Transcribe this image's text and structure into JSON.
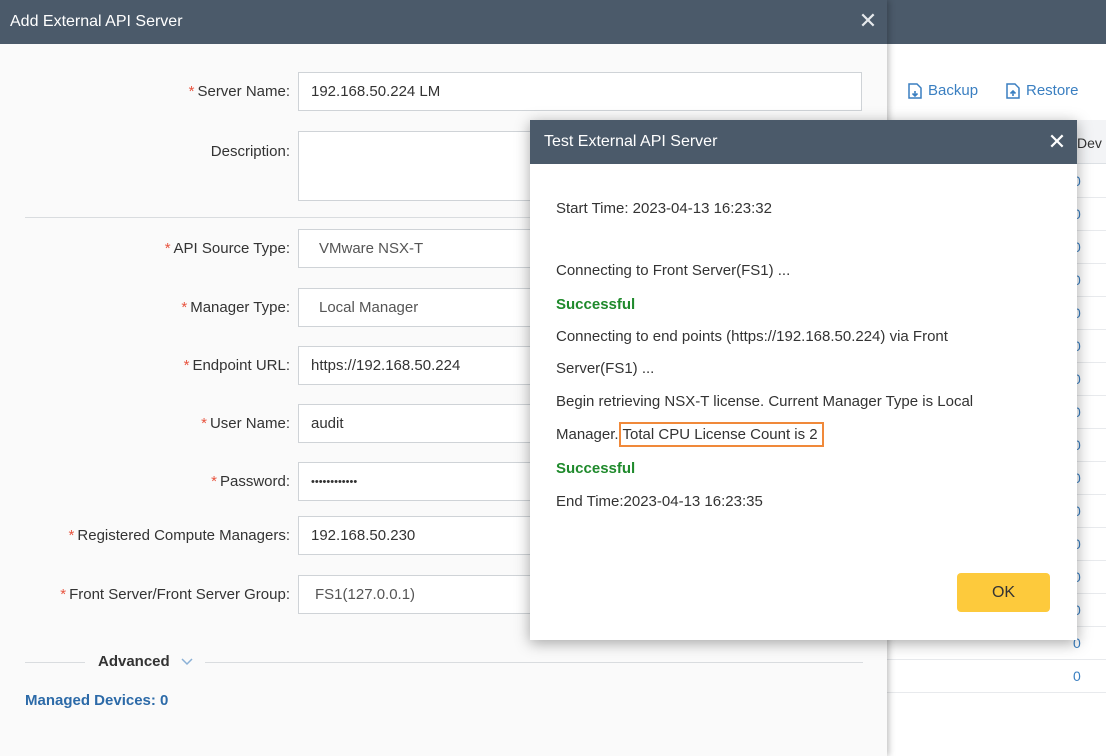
{
  "background": {
    "toolbar": {
      "backup_label": "Backup",
      "restore_label": "Restore"
    },
    "table": {
      "column_label": "Dev",
      "row_values": [
        "0",
        "0",
        "0",
        "0",
        "0",
        "0",
        "0",
        "0",
        "0",
        "0",
        "0",
        "0",
        "0",
        "0",
        "0",
        "0"
      ]
    }
  },
  "dialog": {
    "title": "Add External API Server",
    "required_mark": "*",
    "fields": {
      "server_name": {
        "label": "Server Name:",
        "value": "192.168.50.224 LM"
      },
      "description": {
        "label": "Description:",
        "value": ""
      },
      "api_source_type": {
        "label": "API Source Type:",
        "value": "VMware NSX-T"
      },
      "manager_type": {
        "label": "Manager Type:",
        "value": "Local Manager"
      },
      "endpoint_url": {
        "label": "Endpoint URL:",
        "value": "https://192.168.50.224"
      },
      "user_name": {
        "label": "User Name:",
        "value": "audit"
      },
      "password": {
        "label": "Password:",
        "value": "••••••••••••"
      },
      "compute_managers": {
        "label": "Registered Compute Managers:",
        "value": "192.168.50.230"
      },
      "front_server": {
        "label": "Front Server/Front Server Group:",
        "value": "FS1(127.0.0.1)"
      }
    },
    "advanced_label": "Advanced",
    "managed_devices": "Managed Devices: 0"
  },
  "modal": {
    "title": "Test External API Server",
    "log": {
      "start_time": "Start Time: 2023-04-13 16:23:32",
      "connecting_front": "Connecting to Front Server(FS1) ...",
      "successful_1": "Successful",
      "connecting_endpoints_1": "Connecting to end points (https://192.168.50.224) via Front",
      "connecting_endpoints_2": "Server(FS1) ...",
      "license_1": "Begin retrieving NSX-T license. Current Manager Type is Local",
      "license_2a": "Manager.",
      "license_2b": "Total CPU License Count is 2",
      "successful_2": "Successful",
      "end_time": "End Time:2023-04-13 16:23:35"
    },
    "ok_label": "OK"
  },
  "colors": {
    "header_bg": "#4b5a6a",
    "success_green": "#1f8a2c",
    "highlight_orange": "#f0893a",
    "ok_button_yellow": "#fdca3c",
    "link_blue": "#3a7fc1",
    "required_red": "#e8543f"
  },
  "icons": {
    "close": "close-icon",
    "backup": "backup-icon",
    "restore": "restore-icon",
    "advanced_toggle": "chevron-down-icon"
  }
}
